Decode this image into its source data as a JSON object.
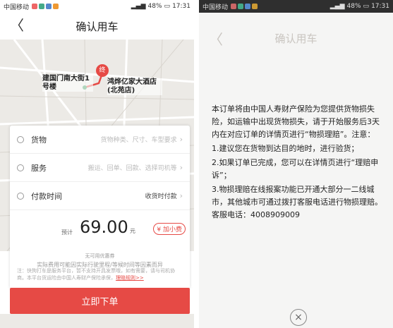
{
  "status": {
    "carrier": "中国移动",
    "battery": "48%",
    "time": "17:31"
  },
  "header": {
    "title": "确认用车",
    "back_symbol": "〈"
  },
  "map": {
    "pin_text": "终",
    "start_label": "建国门南大街1号楼",
    "end_label": "鸿烨亿家大酒店(北苑店)"
  },
  "form": {
    "rows": [
      {
        "label": "货物",
        "hint": "货物种类、尺寸、车型要求",
        "icon": "box-icon"
      },
      {
        "label": "服务",
        "hint": "搬运、回单、回款、选择司机等",
        "icon": "service-icon"
      },
      {
        "label": "付款时间",
        "value": "收货时付款",
        "icon": "clock-icon"
      }
    ],
    "price_prefix": "预计",
    "price": "69.00",
    "price_unit": "元",
    "tip_button": "加小费",
    "coupon_text": "无可用优惠券",
    "fee_note": "实际费用可能因实际行驶里程/等候时间等因素而异",
    "note": "注：快狗打车是服务平台，暂不支持开具发票哦，如有需要，请与司机协商。本平台货运险由中国人寿财产保险承保，",
    "note_link": "理赔规则>>"
  },
  "submit_label": "立即下单",
  "modal": {
    "ghost_title": "确认用车",
    "paragraph": "本订单将由中国人寿财产保险为您提供货物损失险，如运输中出现货物损失，请于开始服务后3天内在对应订单的详情页进行“物损理赔”。注意：",
    "items": [
      "1.建议您在货物到达目的地时，进行验货；",
      "2.如果订单已完成，您可以在详情页进行“理赔申诉”；",
      "3.物损理赔在线报案功能已开通大部分一二线城市，其他城市可通过拨打客服电话进行物损理赔。客服电话：4008909009"
    ],
    "close_symbol": "×"
  },
  "colors": {
    "accent": "#e64a45",
    "map_bg": "#eceae6"
  }
}
